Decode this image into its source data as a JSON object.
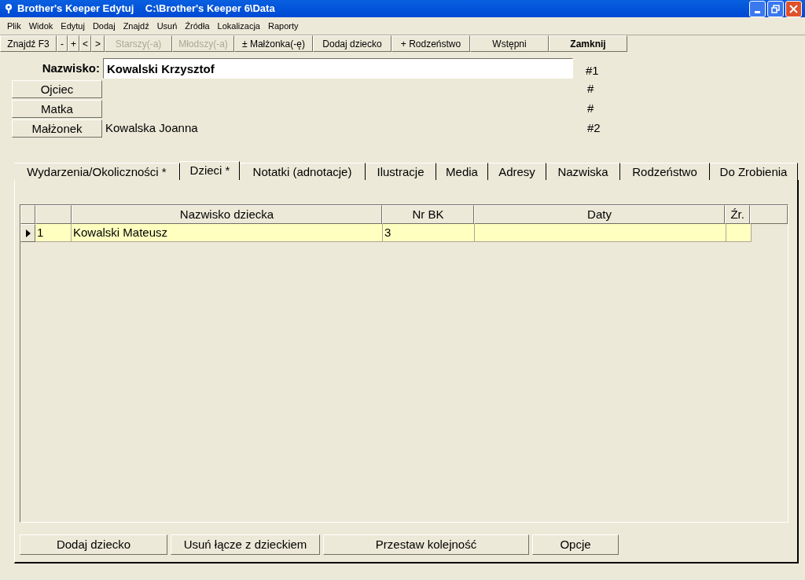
{
  "window": {
    "title": "Brother's Keeper Edytuj    C:\\Brother's Keeper 6\\Data"
  },
  "menu": [
    "Plik",
    "Widok",
    "Edytuj",
    "Dodaj",
    "Znajdź",
    "Usuń",
    "Źródła",
    "Lokalizacja",
    "Raporty"
  ],
  "toolbar": [
    {
      "label": "Znajdź F3",
      "disabled": false,
      "default": false
    },
    {
      "label": "-",
      "disabled": false,
      "default": false
    },
    {
      "label": "+",
      "disabled": false,
      "default": false
    },
    {
      "label": "<",
      "disabled": false,
      "default": false
    },
    {
      "label": ">",
      "disabled": false,
      "default": false
    },
    {
      "label": "Starszy(-a)",
      "disabled": true,
      "default": false
    },
    {
      "label": "Młodszy(-a)",
      "disabled": true,
      "default": false
    },
    {
      "label": "± Małżonka(-ę)",
      "disabled": false,
      "default": false
    },
    {
      "label": "Dodaj dziecko",
      "disabled": false,
      "default": false
    },
    {
      "label": "+ Rodzeństwo",
      "disabled": false,
      "default": false
    },
    {
      "label": "Wstępni",
      "disabled": false,
      "default": false
    },
    {
      "label": "Zamknij",
      "disabled": false,
      "default": true
    }
  ],
  "surname": {
    "label": "Nazwisko:",
    "value": "Kowalski Krzysztof",
    "number": "#1"
  },
  "relations": [
    {
      "button": "Ojciec",
      "number": "#"
    },
    {
      "button": "Matka",
      "number": "#"
    },
    {
      "button": "Małżonek",
      "name": "Kowalska Joanna",
      "number": "#2"
    }
  ],
  "tabs": [
    {
      "label": "Wydarzenia/Okoliczności *",
      "selected": false
    },
    {
      "label": "Dzieci *",
      "selected": true
    },
    {
      "label": "Notatki (adnotacje)",
      "selected": false
    },
    {
      "label": "Ilustracje",
      "selected": false
    },
    {
      "label": "Media",
      "selected": false
    },
    {
      "label": "Adresy",
      "selected": false
    },
    {
      "label": "Nazwiska",
      "selected": false
    },
    {
      "label": "Rodzeństwo",
      "selected": false
    },
    {
      "label": "Do Zrobienia",
      "selected": false
    }
  ],
  "table": {
    "columns": [
      "",
      "Nazwisko dziecka",
      "Nr BK",
      "Daty",
      "Źr."
    ],
    "rows": [
      {
        "selected": true,
        "cells": [
          "1",
          "Kowalski Mateusz",
          "3",
          "",
          ""
        ]
      }
    ]
  },
  "buttons": [
    "Dodaj dziecko",
    "Usuń łącze z dzieckiem",
    "Przestaw kolejność",
    "Opcje"
  ]
}
